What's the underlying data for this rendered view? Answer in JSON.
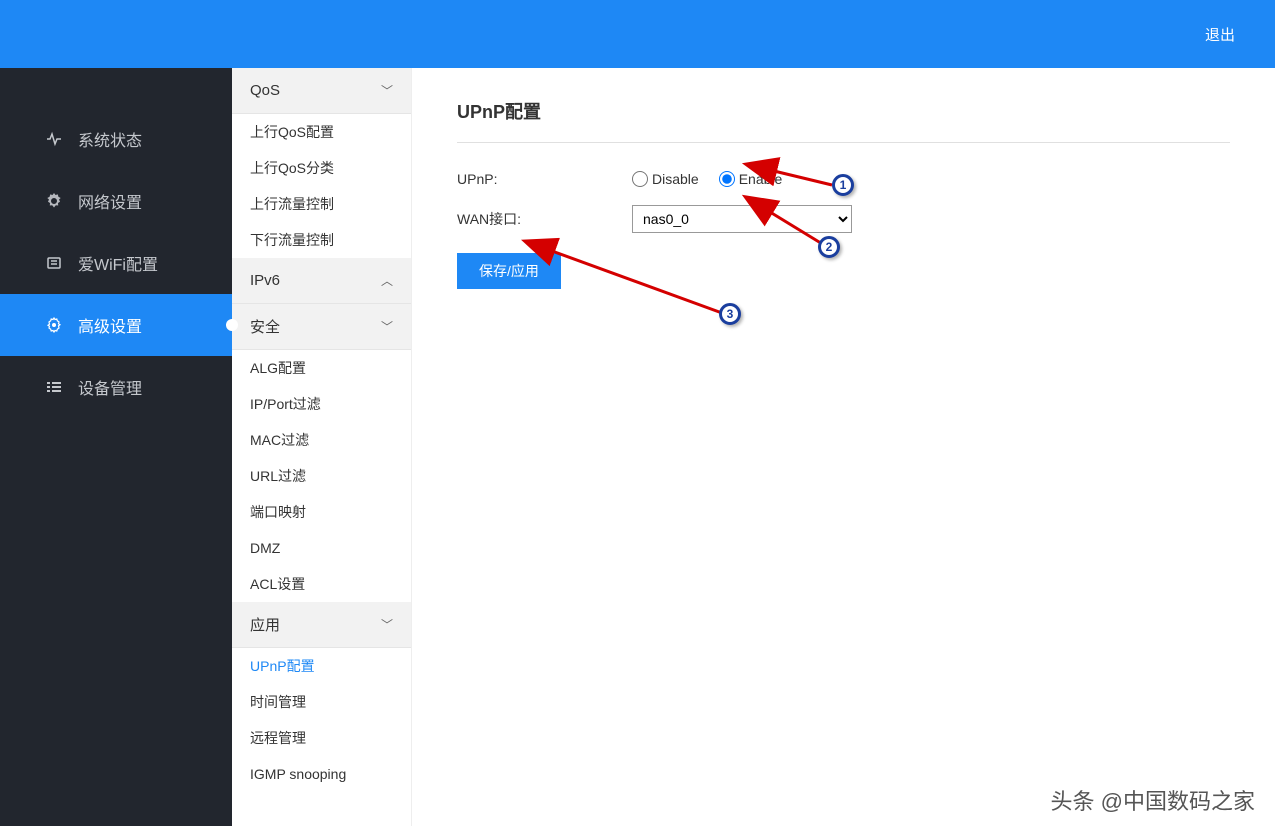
{
  "header": {
    "logout": "退出"
  },
  "sidebar": {
    "items": [
      {
        "label": "系统状态",
        "icon": "pulse"
      },
      {
        "label": "网络设置",
        "icon": "gear"
      },
      {
        "label": "爱WiFi配置",
        "icon": "wifi"
      },
      {
        "label": "高级设置",
        "icon": "gear-small"
      },
      {
        "label": "设备管理",
        "icon": "list"
      }
    ]
  },
  "submenu": {
    "groups": [
      {
        "title": "QoS",
        "expanded": true,
        "chev": "down",
        "items": [
          "上行QoS配置",
          "上行QoS分类",
          "上行流量控制",
          "下行流量控制"
        ]
      },
      {
        "title": "IPv6",
        "expanded": false,
        "chev": "up",
        "items": []
      },
      {
        "title": "安全",
        "expanded": true,
        "chev": "down",
        "items": [
          "ALG配置",
          "IP/Port过滤",
          "MAC过滤",
          "URL过滤",
          "端口映射",
          "DMZ",
          "ACL设置"
        ]
      },
      {
        "title": "应用",
        "expanded": true,
        "chev": "down",
        "items": [
          "UPnP配置",
          "时间管理",
          "远程管理",
          "IGMP snooping"
        ]
      }
    ],
    "activeItem": "UPnP配置"
  },
  "content": {
    "title": "UPnP配置",
    "upnp_label": "UPnP:",
    "disable_label": "Disable",
    "enable_label": "Enable",
    "upnp_value": "Enable",
    "wan_label": "WAN接口:",
    "wan_value": "nas0_0",
    "save_label": "保存/应用"
  },
  "annotations": {
    "badge1": "1",
    "badge2": "2",
    "badge3": "3"
  },
  "watermark": "头条 @中国数码之家"
}
